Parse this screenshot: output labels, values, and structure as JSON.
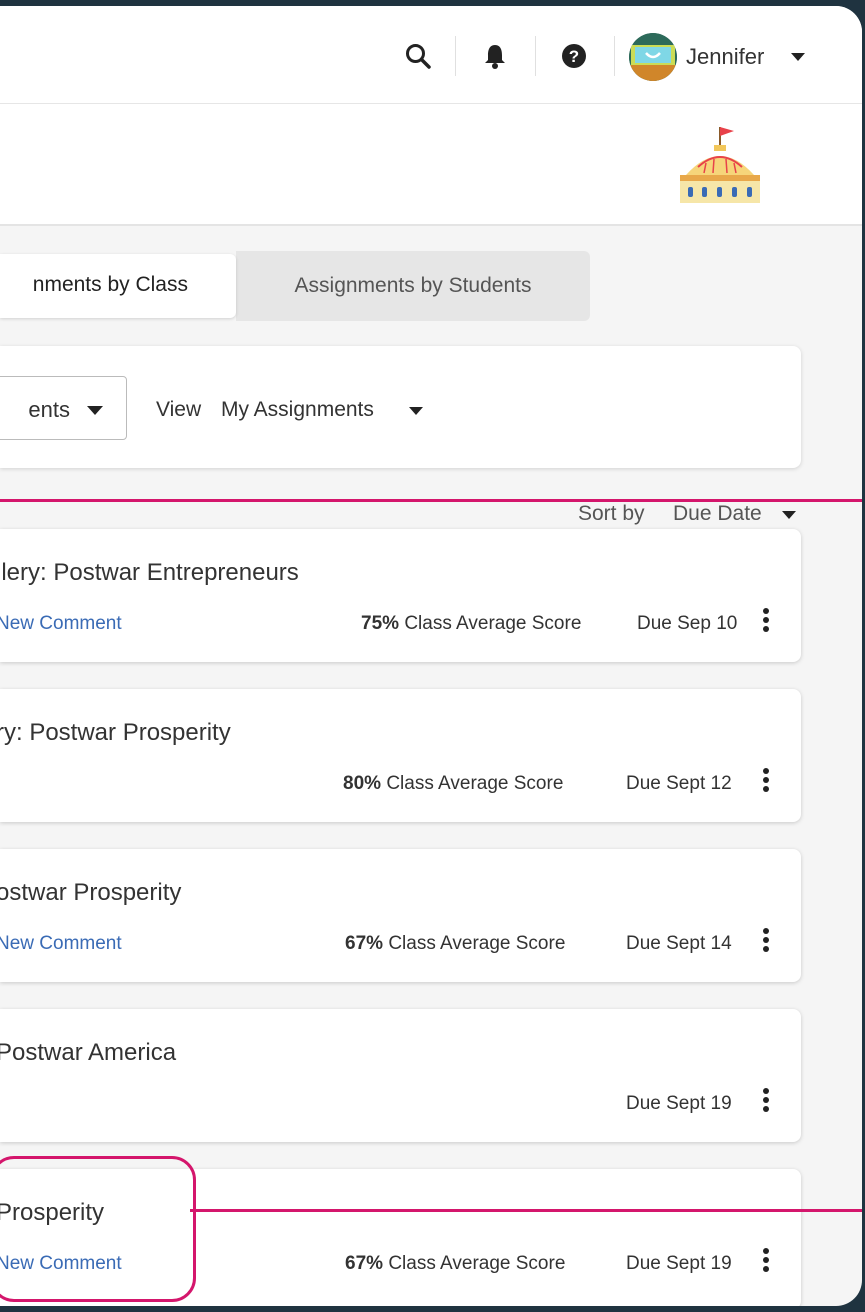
{
  "header": {
    "user_name": "Jennifer",
    "icons": [
      "search-icon",
      "bell-icon",
      "help-icon",
      "chevron-down-icon"
    ]
  },
  "tabs": [
    {
      "label": "Assignments by Class",
      "display": "nments by Class",
      "active": true
    },
    {
      "label": "Assignments by Students",
      "active": false
    }
  ],
  "filters": {
    "select_value": "ents",
    "view_label": "View",
    "view_value": "My Assignments"
  },
  "sort": {
    "label": "Sort by",
    "value": "Due Date"
  },
  "assignments": [
    {
      "title": "llery: Postwar Entrepreneurs",
      "comment": "New Comment",
      "score": "75%",
      "score_label": "Class Average Score",
      "due": "Due Sep 10"
    },
    {
      "title": "ry: Postwar Prosperity",
      "comment": "",
      "score": "80%",
      "score_label": "Class Average Score",
      "due": "Due Sept 12"
    },
    {
      "title": "ostwar Prosperity",
      "comment": "New Comment",
      "score": "67%",
      "score_label": "Class Average Score",
      "due": "Due Sept 14"
    },
    {
      "title": "Postwar America",
      "comment": "",
      "score": "",
      "score_label": "",
      "due": "Due Sept 19"
    },
    {
      "title": "Prosperity",
      "comment": "New Comment",
      "score": "67%",
      "score_label": "Class Average Score",
      "due": "Due Sept 19"
    }
  ],
  "colors": {
    "accent": "#d4166c",
    "link": "#3a6bb5",
    "frame": "#1f3340"
  }
}
